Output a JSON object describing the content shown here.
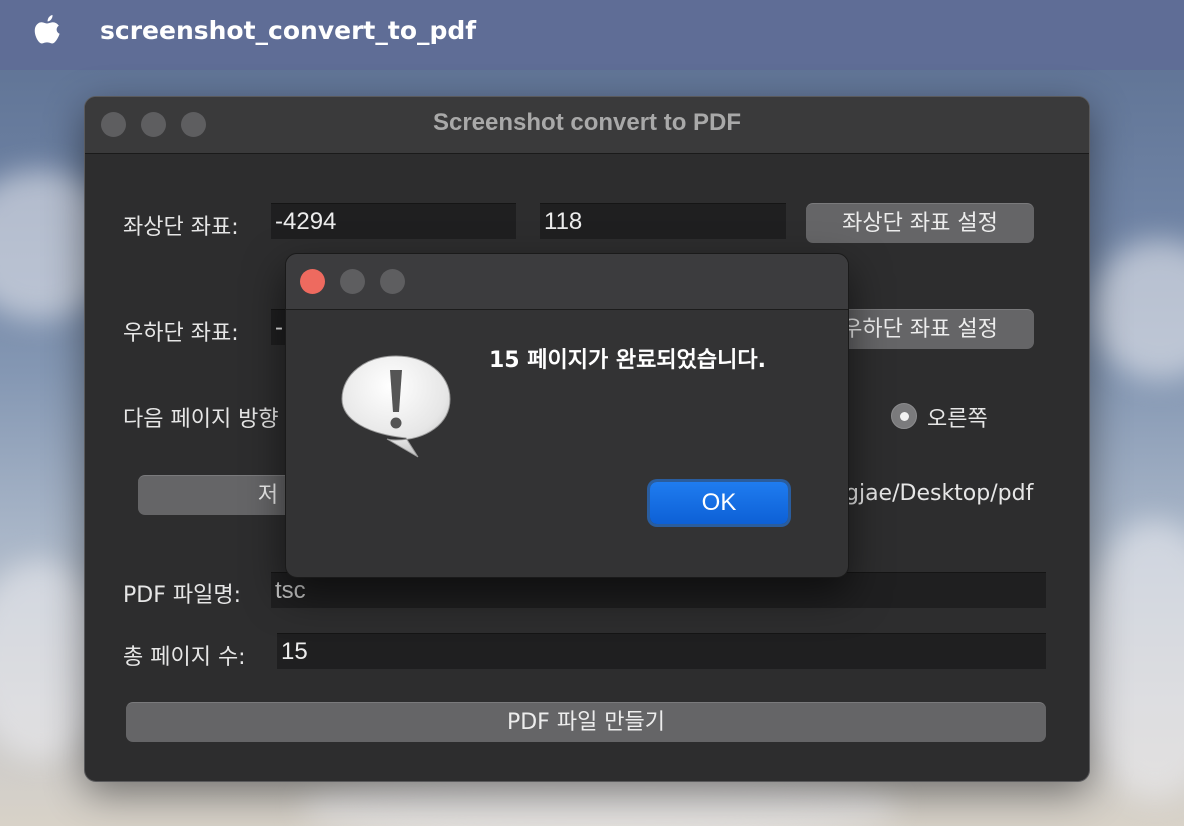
{
  "menubar": {
    "app_name": "screenshot_convert_to_pdf",
    "apple_icon": "apple-logo-icon"
  },
  "window": {
    "title": "Screenshot convert to PDF",
    "top_left": {
      "label": "좌상단 좌표:",
      "x_value": "-4294",
      "y_value": "118",
      "set_button": "좌상단 좌표 설정"
    },
    "bottom_right": {
      "label": "우하단 좌표:",
      "x_value": "-",
      "set_button": "우하단 좌표 설정"
    },
    "next_page_direction": {
      "label": "다음 페이지 방향",
      "options": [
        {
          "label": "오른쪽",
          "selected": true
        }
      ]
    },
    "save_location": {
      "button_label": "저",
      "path": "gjae/Desktop/pdf"
    },
    "pdf_filename": {
      "label": "PDF 파일명:",
      "value": "tsc"
    },
    "total_pages": {
      "label": "총 페이지 수:",
      "value": "15"
    },
    "make_pdf_button": "PDF 파일 만들기"
  },
  "alert": {
    "icon": "caution-speech-bubble-icon",
    "message": "15 페이지가 완료되었습니다.",
    "ok_button": "OK"
  },
  "colors": {
    "close_red": "#ee6a5f",
    "inactive_light": "#5e5e60",
    "accent_blue": "#1a71e8"
  }
}
